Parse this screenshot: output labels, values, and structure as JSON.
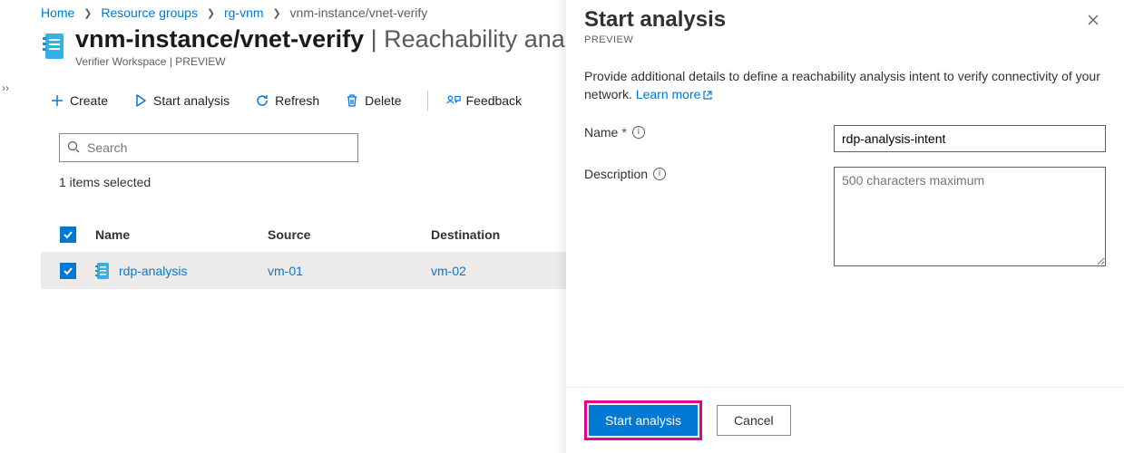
{
  "breadcrumbs": [
    {
      "label": "Home"
    },
    {
      "label": "Resource groups"
    },
    {
      "label": "rg-vnm"
    },
    {
      "label": "vnm-instance/vnet-verify"
    }
  ],
  "page": {
    "title_main": "vnm-instance/vnet-verify",
    "title_sub": "Reachability analysis",
    "subtitle": "Verifier Workspace | PREVIEW"
  },
  "toolbar": {
    "create": "Create",
    "start": "Start analysis",
    "refresh": "Refresh",
    "delete": "Delete",
    "feedback": "Feedback"
  },
  "search": {
    "placeholder": "Search"
  },
  "selection_status": "1 items selected",
  "table": {
    "headers": {
      "name": "Name",
      "source": "Source",
      "destination": "Destination"
    },
    "rows": [
      {
        "name": "rdp-analysis",
        "source": "vm-01",
        "destination": "vm-02"
      }
    ]
  },
  "panel": {
    "title": "Start analysis",
    "subtitle": "PREVIEW",
    "lead": "Provide additional details to define a reachability analysis intent to verify connectivity of your network.",
    "learn_more": "Learn more",
    "name_label": "Name",
    "name_value": "rdp-analysis-intent",
    "desc_label": "Description",
    "desc_placeholder": "500 characters maximum",
    "primary_btn": "Start analysis",
    "secondary_btn": "Cancel"
  }
}
